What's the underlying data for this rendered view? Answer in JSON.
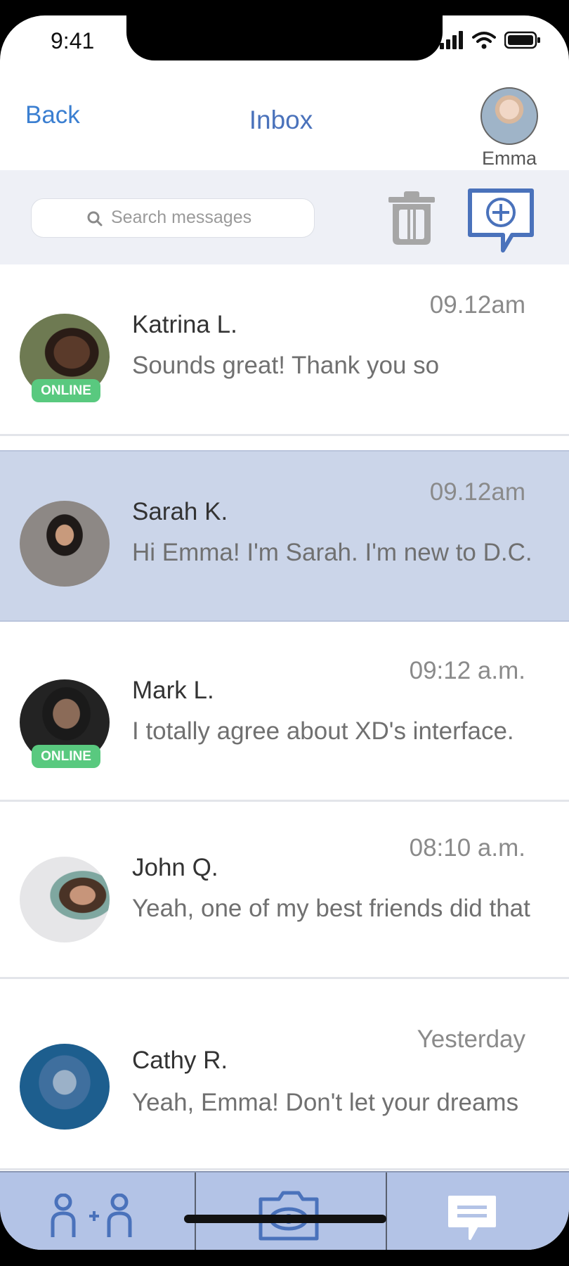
{
  "status_bar": {
    "time": "9:41"
  },
  "header": {
    "back_label": "Back",
    "title": "Inbox",
    "user_name": "Emma"
  },
  "toolbar": {
    "search_placeholder": "Search messages"
  },
  "colors": {
    "accent": "#4a72bb",
    "link": "#3b7fd1",
    "selected_row": "#cbd5e9",
    "online": "#59c97f",
    "tabbar": "#b3c3e6"
  },
  "conversations": [
    {
      "name": "Katrina L.",
      "preview": "Sounds great! Thank you so",
      "time": "09.12am",
      "badge": "ONLINE",
      "selected": false
    },
    {
      "name": "Sarah K.",
      "preview": "Hi Emma! I'm Sarah. I'm new to D.C.",
      "time": "09.12am",
      "badge": "",
      "selected": true
    },
    {
      "name": "Mark L.",
      "preview": "I totally agree about XD's interface.",
      "time": "09:12 a.m.",
      "badge": "ONLINE",
      "selected": false
    },
    {
      "name": "John Q.",
      "preview": "Yeah, one of my best friends did that",
      "time": "08:10 a.m.",
      "badge": "",
      "selected": false
    },
    {
      "name": "Cathy R.",
      "preview": "Yeah, Emma! Don't let your dreams",
      "time": "Yesterday",
      "badge": "",
      "selected": false
    }
  ],
  "tabs": [
    {
      "icon": "add-friend-icon"
    },
    {
      "icon": "camera-icon"
    },
    {
      "icon": "chat-icon"
    }
  ]
}
